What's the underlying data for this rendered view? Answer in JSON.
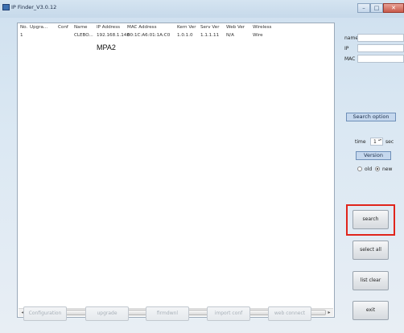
{
  "window": {
    "title": "IP Finder_V3.0.12",
    "controls": {
      "minimize": "–",
      "maximize": "□",
      "close": "✕"
    }
  },
  "table": {
    "columns": [
      "No.",
      "Upgra...",
      "Conf",
      "Name",
      "IP Address",
      "MAC Address",
      "Kern Ver",
      "Serv Ver",
      "Web Ver",
      "Wireless"
    ],
    "rows": [
      [
        "1",
        "",
        "",
        "CLEBO...",
        "192.168.1.148",
        "00:1C:A6:01:1A:C0",
        "1.0.1.0",
        "1.1.1.11",
        "N/A",
        "Wire"
      ]
    ],
    "row_extra_text": "MPA2",
    "scroll": {
      "left": "◂",
      "right": "▸",
      "grip": "|||"
    }
  },
  "side": {
    "name_label": "name",
    "ip_label": "IP",
    "mac_label": "MAC",
    "search_option_header": "Search option",
    "time_label": "time",
    "time_value": "1",
    "time_unit": "sec",
    "spin_arrows": "▴▾",
    "version_header": "Version",
    "version_old": "old",
    "version_new": "new",
    "version_selected": "new"
  },
  "buttons": {
    "search": "search",
    "select_all": "select all",
    "list_clear": "list clear",
    "exit": "exit"
  },
  "bottom_buttons": [
    "Configuration",
    "upgrade",
    "firmdwnl",
    "import conf",
    "web connect"
  ],
  "colors": {
    "highlight": "#e0251c",
    "section_header": "#c5d8ee"
  }
}
